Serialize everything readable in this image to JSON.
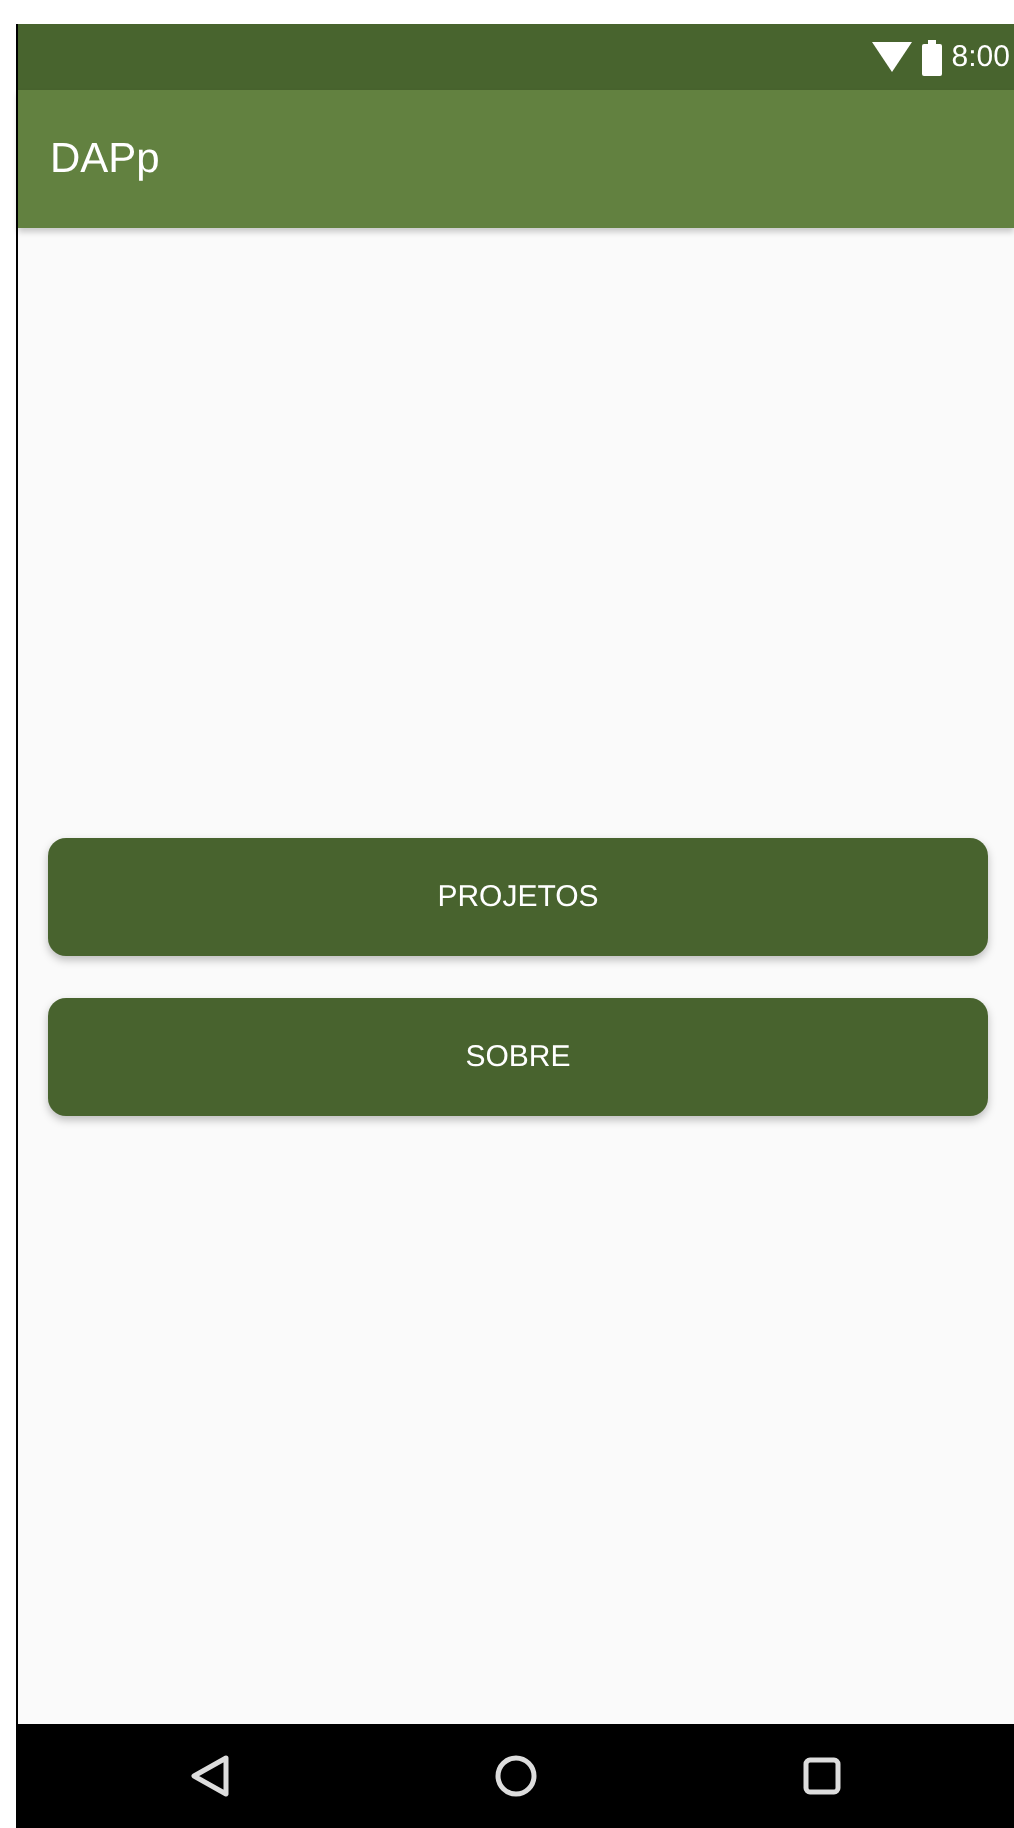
{
  "status_bar": {
    "time": "8:00"
  },
  "app_bar": {
    "title": "DAPp"
  },
  "buttons": [
    {
      "label": "PROJETOS"
    },
    {
      "label": "SOBRE"
    }
  ]
}
